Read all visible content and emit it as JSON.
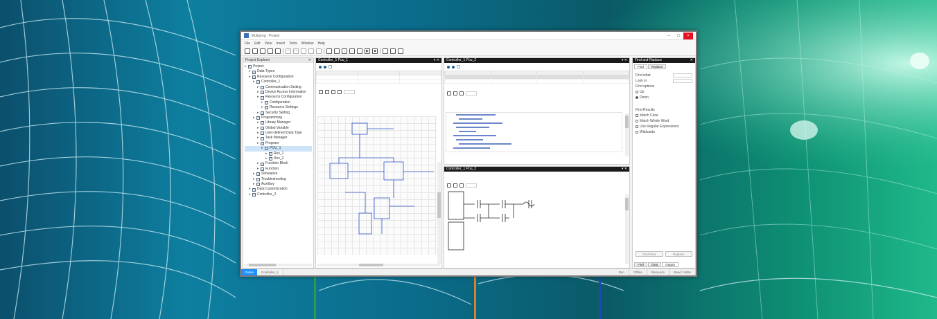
{
  "window": {
    "title": "Multiprog - Project",
    "menu": [
      "File",
      "Edit",
      "View",
      "Insert",
      "Tools",
      "Window",
      "Help"
    ]
  },
  "colors": {
    "connector_green": "#2e9b47",
    "connector_orange": "#d9822b",
    "connector_blue": "#1f4aa8",
    "status_online": "#1e90ff"
  },
  "project_explorer": {
    "title": "Project Explorer",
    "items": [
      {
        "label": "Project",
        "indent": 0
      },
      {
        "label": "Data Types",
        "indent": 1
      },
      {
        "label": "Resource Configuration",
        "indent": 1
      },
      {
        "label": "Controller_1",
        "indent": 2
      },
      {
        "label": "Communication Setting",
        "indent": 3
      },
      {
        "label": "Device Access Information",
        "indent": 3
      },
      {
        "label": "Resource Configuration",
        "indent": 3
      },
      {
        "label": "Configuration",
        "indent": 4
      },
      {
        "label": "Resource Settings",
        "indent": 4
      },
      {
        "label": "Security Setting",
        "indent": 3
      },
      {
        "label": "Programming",
        "indent": 2
      },
      {
        "label": "Library Manager",
        "indent": 3
      },
      {
        "label": "Global Variable",
        "indent": 3
      },
      {
        "label": "User-defined Data Type",
        "indent": 3
      },
      {
        "label": "Task Manager",
        "indent": 3
      },
      {
        "label": "Program",
        "indent": 3
      },
      {
        "label": "POU_1",
        "indent": 4
      },
      {
        "label": "Rev_1",
        "indent": 5
      },
      {
        "label": "Rev_2",
        "indent": 5
      },
      {
        "label": "Function Block",
        "indent": 3
      },
      {
        "label": "Function",
        "indent": 3
      },
      {
        "label": "Simulation",
        "indent": 2
      },
      {
        "label": "Troubleshooting",
        "indent": 2
      },
      {
        "label": "Auxiliary",
        "indent": 2
      },
      {
        "label": "Data Customization",
        "indent": 1
      },
      {
        "label": "Controller_2",
        "indent": 1
      }
    ],
    "selected_index": 16
  },
  "pane_fbd": {
    "title": "Controller_1 Pou_1"
  },
  "pane_vars": {
    "title": "Controller_1 Pou_2"
  },
  "pane_ld": {
    "title": "Controller_1 Pou_2"
  },
  "properties": {
    "title": "Find and Replace",
    "tabs": [
      "Find",
      "Replace"
    ],
    "labels": [
      "Find what",
      "Look in",
      "Find options",
      "Find Results"
    ],
    "radios": [
      "Up",
      "Down"
    ],
    "checks": [
      "Match Case",
      "Match Whole Word",
      "Use Regular Expressions",
      "Wildcards"
    ],
    "buttons": [
      "Find Next",
      "Replace"
    ],
    "bottom_tabs": [
      "Find",
      "Data",
      "Output"
    ]
  },
  "status": {
    "mode": "Online",
    "cells": [
      "Controller_1",
      "Run",
      "Offline",
      "Resource",
      "Read / Write"
    ]
  }
}
